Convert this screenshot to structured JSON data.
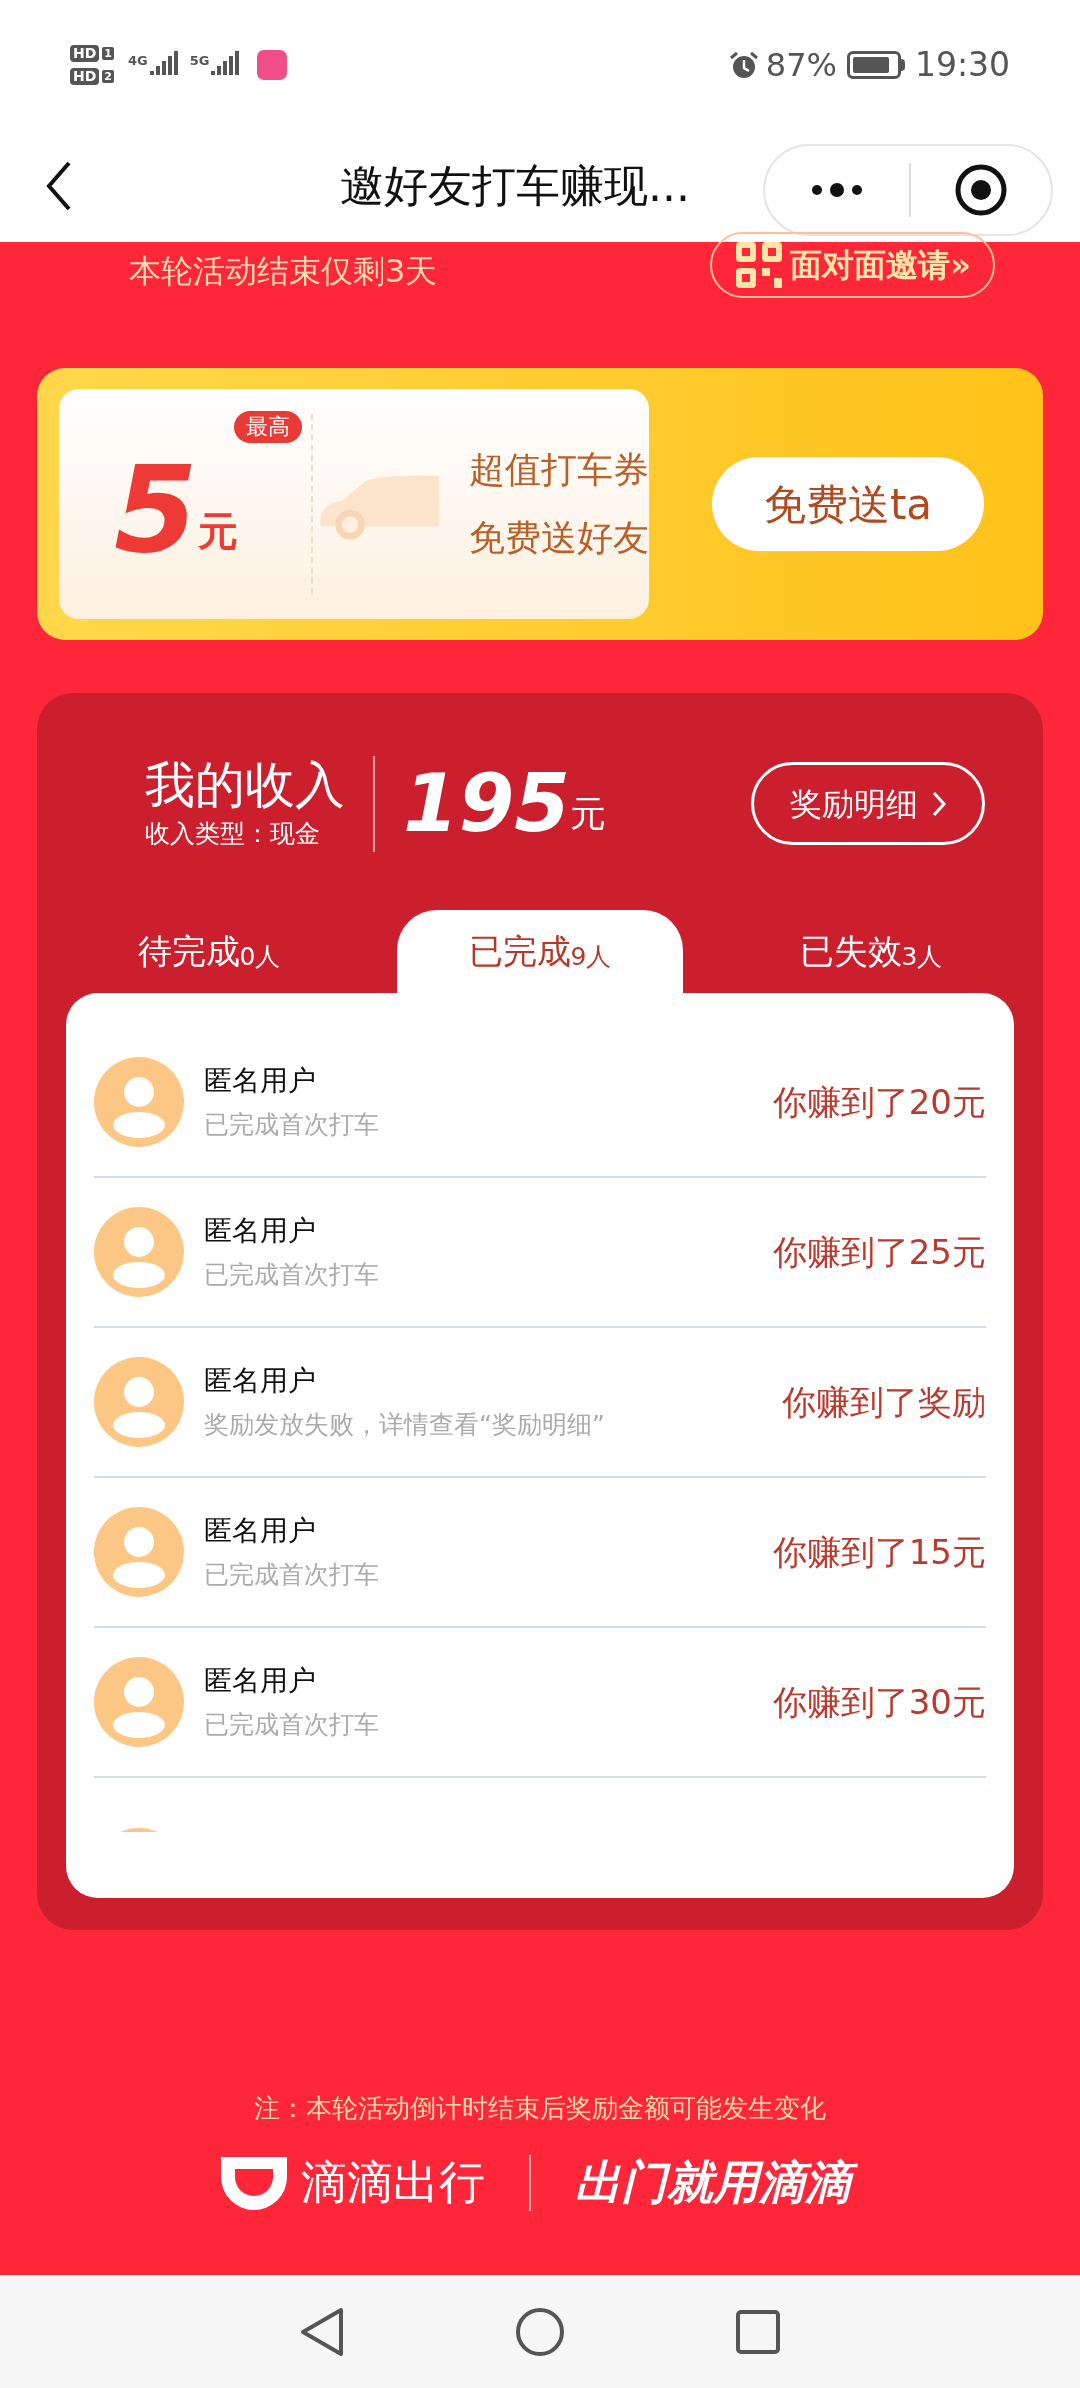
{
  "status_bar": {
    "sims": [
      {
        "label": "HD",
        "slot": "1"
      },
      {
        "label": "HD",
        "slot": "2"
      }
    ],
    "networks": [
      "4G",
      "5G"
    ],
    "battery": "87%",
    "time": "19:30"
  },
  "header": {
    "title": "邀好友打车赚现..."
  },
  "banner": {
    "countdown": "本轮活动结束仅剩3天",
    "invite_button": "面对面邀请»"
  },
  "coupon": {
    "badge": "最高",
    "amount": "5",
    "unit": "元",
    "lines": [
      "超值打车券",
      "免费送好友"
    ],
    "button": "免费送ta"
  },
  "income": {
    "title": "我的收入",
    "type": "收入类型：现金",
    "amount": "195",
    "unit": "元",
    "detail_button": "奖励明细"
  },
  "tabs": [
    {
      "label": "待完成",
      "count": "0人",
      "selected": false
    },
    {
      "label": "已完成",
      "count": "9人",
      "selected": true
    },
    {
      "label": "已失效",
      "count": "3人",
      "selected": false
    }
  ],
  "rows": [
    {
      "name": "匿名用户",
      "status": "已完成首次打车",
      "earning": "你赚到了20元"
    },
    {
      "name": "匿名用户",
      "status": "已完成首次打车",
      "earning": "你赚到了25元"
    },
    {
      "name": "匿名用户",
      "status": "奖励发放失败，详情查看“奖励明细”",
      "earning": "你赚到了奖励"
    },
    {
      "name": "匿名用户",
      "status": "已完成首次打车",
      "earning": "你赚到了15元"
    },
    {
      "name": "匿名用户",
      "status": "已完成首次打车",
      "earning": "你赚到了30元"
    }
  ],
  "footer": {
    "note": "注：本轮活动倒计时结束后奖励金额可能发生变化",
    "brand": "滴滴出行",
    "slogan": "出门就用滴滴"
  }
}
